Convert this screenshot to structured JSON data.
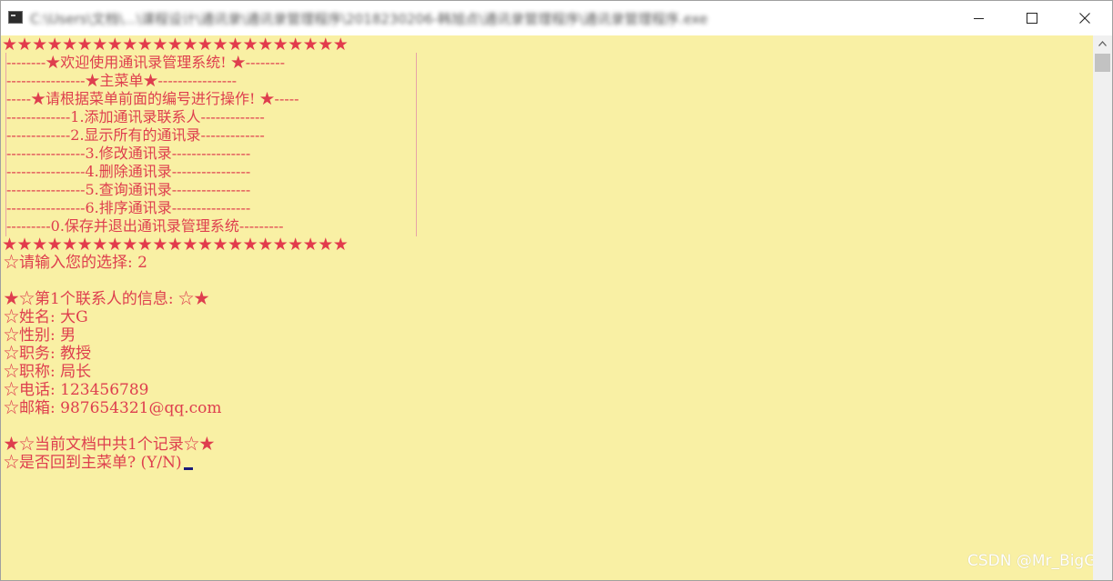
{
  "window": {
    "title": "C:\\Users\\文档\\...\\课程设计\\通讯录\\通讯录管理程序\\2018230206-韩旭点\\通讯录管理程序\\通讯录管理程序.exe"
  },
  "console": {
    "star_row": "★★★★★★★★★★★★★★★★★★★★★★★",
    "menu": [
      "--------★欢迎使用通讯录管理系统! ★--------",
      "----------------★主菜单★----------------",
      "-----★请根据菜单前面的编号进行操作! ★-----",
      "-------------1.添加通讯录联系人-------------",
      "-------------2.显示所有的通讯录-------------",
      "----------------3.修改通讯录----------------",
      "----------------4.删除通讯录----------------",
      "----------------5.查询通讯录----------------",
      "----------------6.排序通讯录----------------",
      "---------0.保存并退出通讯录管理系统---------"
    ],
    "prompt_choice": "☆请输入您的选择: 2",
    "contact_header": "★☆第1个联系人的信息: ☆★",
    "contact_fields": [
      "☆姓名: 大G",
      "☆性别: 男",
      "☆职务: 教授",
      "☆职称: 局长",
      "☆电话: 123456789",
      "☆邮箱: 987654321@qq.com"
    ],
    "record_count": "★☆当前文档中共1个记录☆★",
    "return_prompt": "☆是否回到主菜单? (Y/N)"
  },
  "watermark": "CSDN @Mr_BigG",
  "colors": {
    "console_bg": "#f9f0a4",
    "console_text": "#de3e4e",
    "cursor": "#1a1a7a"
  }
}
